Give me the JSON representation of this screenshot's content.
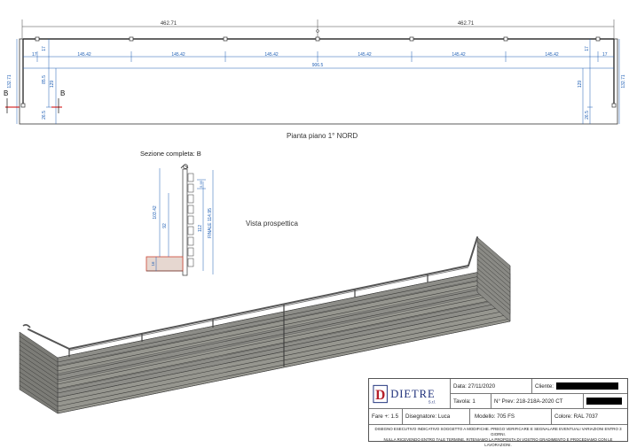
{
  "dims": {
    "half_width_left": "462.71",
    "half_width_right": "462.71",
    "end_offset_left": "17",
    "end_offset_right": "17",
    "spans": [
      "145.42",
      "145.42",
      "145.42",
      "145.42",
      "145.42",
      "145.42"
    ],
    "total_length": "906.5",
    "left_depth": "132.71",
    "right_depth": "132.71",
    "left_inner": "129",
    "right_inner": "129",
    "left_mid": "85.5",
    "left_bottom": "26.5",
    "right_bottom": "26.5",
    "left_top": "17",
    "right_top": "17",
    "section_mark_left": "B",
    "section_mark_right": "B"
  },
  "plan_title": "Pianta piano 1° NORD",
  "section": {
    "title": "Sezione completa: B",
    "dim_overall": "103.42",
    "dim_inner": "92",
    "dim_right": "112",
    "dim_finish": "FINALE 114.95",
    "dim_small_top": "5.95",
    "dim_base": "16"
  },
  "view_title": "Vista prospettica",
  "title_block": {
    "logo_letter": "D",
    "company": "DIETRE",
    "company_suffix": "S.r.l.",
    "date_label": "Data: 27/11/2020",
    "client_label": "Cliente:",
    "table_label": "Tavola: 1",
    "prev_label": "N° Prev: 218-218A-2020 CT",
    "scale_label": "Fare +: 1.5",
    "designer_label": "Disegnatore: Luca",
    "model_label": "Modello: 705 FS",
    "color_label": "Colore: RAL 7037",
    "footer_line1": "DISEGNO ESECUTIVO INDICATIVO SOGGETTO A MODIFICHE. PREGO VERIFICARE E SEGNALARE EVENTUALI VARIAZIONI ENTRO 3 GIORNI.",
    "footer_line2": "NULLA RICEVENDO ENTRO TALE TERMINE, RITENIAMO LA PROPOSTA DI VOSTRO GRADIMENTO E PROCEDIAMO CON LE LAVORAZIONI."
  },
  "colors": {
    "line": "#2a2a2a",
    "dim_blue": "#1f5fb5",
    "rail_gray": "#8a8a85",
    "rail_dark": "#5a5a56",
    "logo_red": "#b51f2a",
    "logo_blue": "#1d2f7a"
  }
}
